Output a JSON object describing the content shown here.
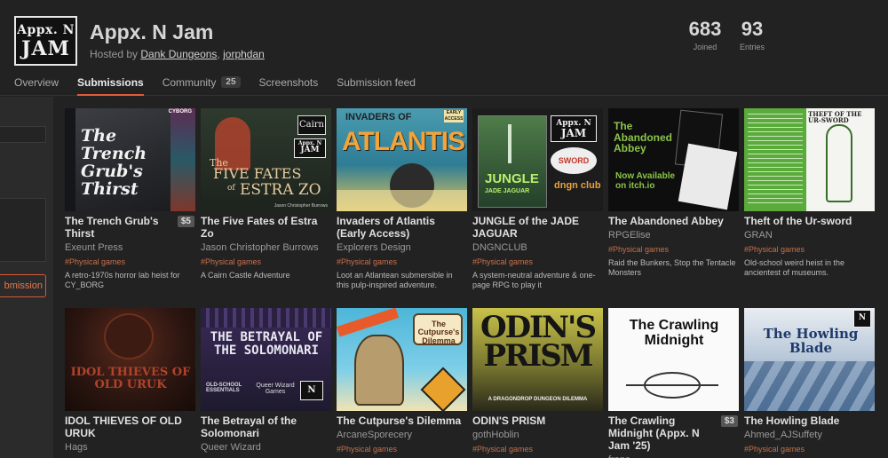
{
  "header": {
    "logo_line1": "Appx. N",
    "logo_line2": "JAM",
    "title": "Appx. N Jam",
    "hosted_prefix": "Hosted by",
    "hosts": [
      "Dank Dungeons",
      "jorphdan"
    ],
    "host_sep": ",",
    "stats": [
      {
        "num": "683",
        "label": "Joined"
      },
      {
        "num": "93",
        "label": "Entries"
      }
    ],
    "tabs": [
      {
        "label": "Overview"
      },
      {
        "label": "Submissions",
        "active": true
      },
      {
        "label": "Community",
        "badge": "25"
      },
      {
        "label": "Screenshots"
      },
      {
        "label": "Submission feed"
      }
    ]
  },
  "sidebar": {
    "button_label": "bmission"
  },
  "entries": [
    {
      "title": "The Trench Grub's Thirst",
      "price": "$5",
      "author": "Exeunt Press",
      "tag": "#Physical games",
      "desc": "A retro-1970s horror lab heist for CY_BORG",
      "cover": {
        "text": "The Trench Grub's Thirst",
        "top": "CYBORG"
      }
    },
    {
      "title": "The Five Fates of Estra Zo",
      "author": "Jason Christopher Burrows",
      "tag": "#Physical games",
      "desc": "A Cairn Castle Adventure",
      "cover": {
        "text": "FIVE FATES",
        "sub": "ESTRA ZO",
        "the": "The",
        "of": "of",
        "brand": "Cairn",
        "byline": "Jason Christopher Burrows"
      }
    },
    {
      "title": "Invaders of Atlantis (Early Access)",
      "author": "Explorers Design",
      "tag": "#Physical games",
      "desc": "Loot an Atlantean submersible in this pulp-inspired adventure.",
      "cover": {
        "text": "INVADERS OF",
        "big": "ATLANTIS",
        "corner": "EARLY ACCESS"
      }
    },
    {
      "title": "JUNGLE of the JADE JAGUAR",
      "author": "DNGNCLUB",
      "tag": "#Physical games",
      "desc": "A system-neutral adventure & one-page RPG to play it",
      "cover": {
        "text": "JUNGLE",
        "sub": "JADE JAGUAR",
        "sword": "SWORD",
        "club": "dngn club"
      }
    },
    {
      "title": "The Abandoned Abbey",
      "author": "RPGElise",
      "tag": "#Physical games",
      "desc": "Raid the Bunkers, Stop the Tentacle Monsters",
      "cover": {
        "text": "The Abandoned Abbey",
        "avail": "Now Available on itch.io"
      }
    },
    {
      "title": "Theft of the Ur-sword",
      "author": "GRAN",
      "tag": "#Physical games",
      "desc": "Old-school weird heist in the ancientest of museums.",
      "cover": {
        "text": "THEFT OF THE UR-SWORD"
      }
    },
    {
      "title": "IDOL THIEVES OF OLD URUK",
      "author": "Hags",
      "cover": {
        "text": "IDOL THIEVES OF OLD URUK"
      }
    },
    {
      "title": "The Betrayal of the Solomonari",
      "author": "Queer Wizard",
      "cover": {
        "text": "THE BETRAYAL OF THE SOLOMONARI",
        "sub": "OLD-SCHOOL ESSENTIALS",
        "brand": "Queer Wizard Games"
      }
    },
    {
      "title": "The Cutpurse's Dilemma",
      "author": "ArcaneSporecery",
      "tag": "#Physical games",
      "cover": {
        "text": "The Cutpurse's Dilemma"
      }
    },
    {
      "title": "ODIN'S PRISM",
      "author": "gothHoblin",
      "tag": "#Physical games",
      "cover": {
        "text": "ODIN'S PRISM",
        "sub": "A DRAGONDROP DUNGEON DILEMMA"
      }
    },
    {
      "title": "The Crawling Midnight (Appx. N Jam '25)",
      "price": "$3",
      "author": "franc",
      "cover": {
        "text": "The Crawling Midnight"
      }
    },
    {
      "title": "The Howling Blade",
      "author": "Ahmed_AJSuffety",
      "tag": "#Physical games",
      "cover": {
        "text": "The Howling Blade"
      }
    }
  ]
}
